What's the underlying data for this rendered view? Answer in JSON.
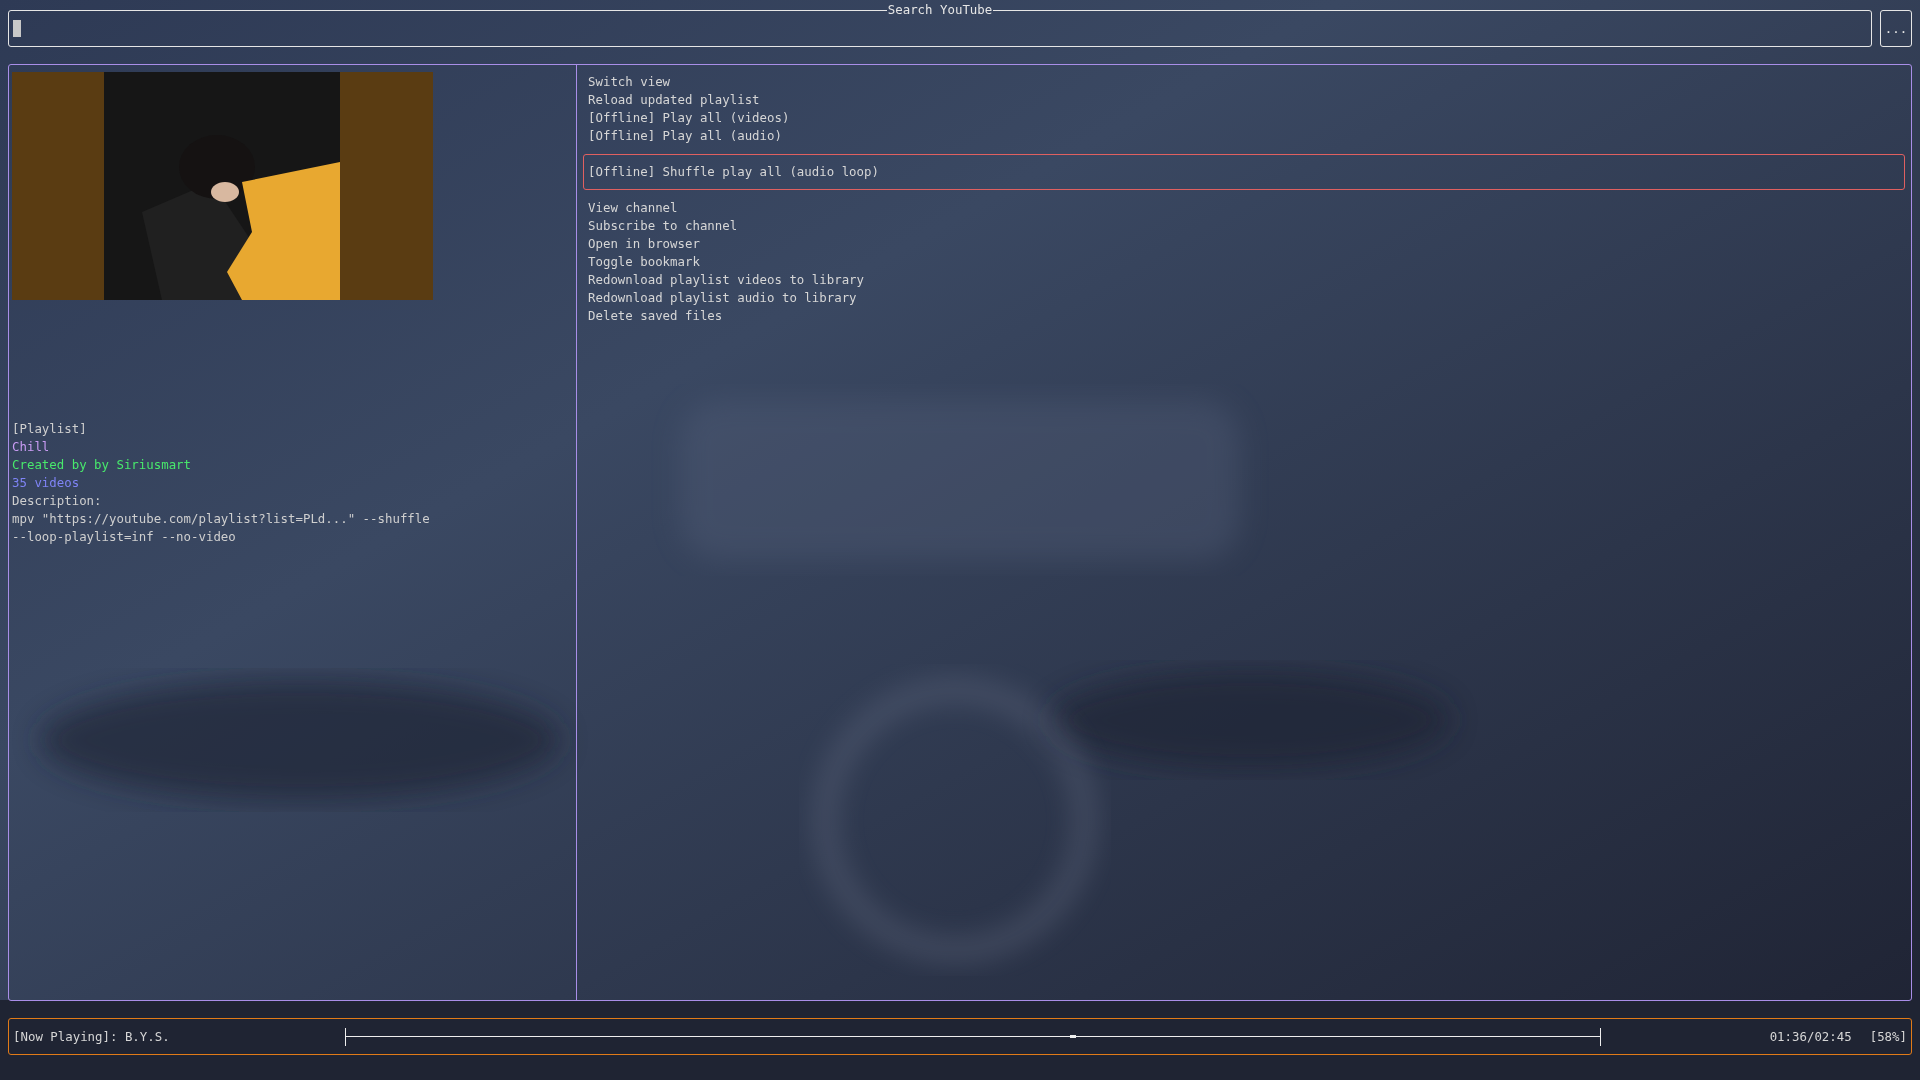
{
  "search": {
    "title": "Search YouTube",
    "menu_button": "..."
  },
  "details": [
    {
      "kind": "type",
      "text": "[Playlist]"
    },
    {
      "kind": "title",
      "text": "Chill"
    },
    {
      "kind": "author",
      "text": "Created by by Siriusmart"
    },
    {
      "kind": "count",
      "text": "35 videos"
    },
    {
      "kind": "plain",
      "text": "Description:"
    },
    {
      "kind": "plain",
      "text": "mpv \"https://youtube.com/playlist?list=PLd...\" --shuffle"
    },
    {
      "kind": "plain",
      "text": "--loop-playlist=inf --no-video"
    }
  ],
  "menu": [
    {
      "label": "Switch view",
      "selected": false
    },
    {
      "label": "Reload updated playlist",
      "selected": false
    },
    {
      "label": "[Offline] Play all (videos)",
      "selected": false
    },
    {
      "label": "[Offline] Play all (audio)",
      "selected": false
    },
    {
      "label": "[Offline] Shuffle play all (audio loop)",
      "selected": true
    },
    {
      "label": "View channel",
      "selected": false
    },
    {
      "label": "Subscribe to channel",
      "selected": false
    },
    {
      "label": "Open in browser",
      "selected": false
    },
    {
      "label": "Toggle bookmark",
      "selected": false
    },
    {
      "label": "Redownload playlist videos to library",
      "selected": false
    },
    {
      "label": "Redownload playlist audio to library",
      "selected": false
    },
    {
      "label": "Delete saved files",
      "selected": false
    }
  ],
  "player": {
    "now_playing": "[Now Playing]: B.Y.S.",
    "level": 0.58,
    "time": "01:36/02:45",
    "percent": "[58%]"
  }
}
